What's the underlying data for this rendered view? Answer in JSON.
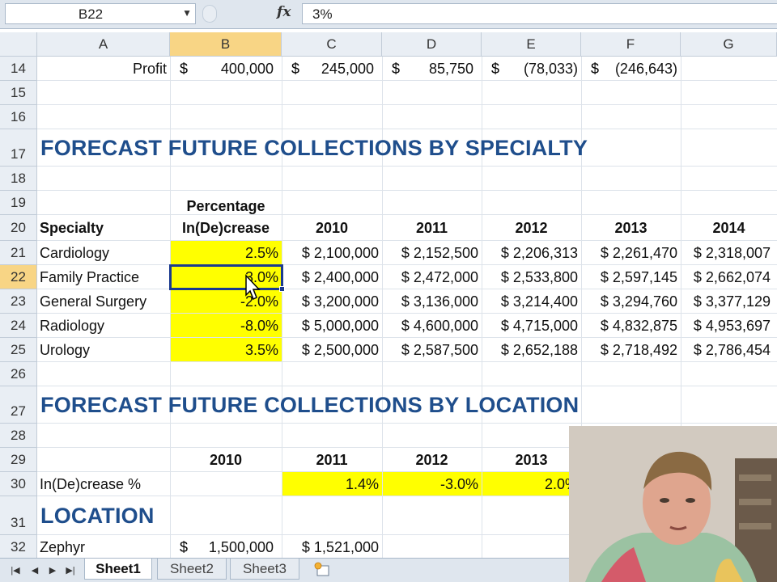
{
  "formula_bar": {
    "name_box": "B22",
    "fx_label": "fx",
    "content": "3%"
  },
  "columns": [
    "A",
    "B",
    "C",
    "D",
    "E",
    "F",
    "G"
  ],
  "rows": [
    "14",
    "15",
    "16",
    "17",
    "18",
    "19",
    "20",
    "21",
    "22",
    "23",
    "24",
    "25",
    "26",
    "27",
    "28",
    "29",
    "30",
    "31",
    "32"
  ],
  "profit_row": {
    "label": "Profit",
    "currency": "$",
    "values": [
      "400,000",
      "245,000",
      "85,750",
      "(78,033)",
      "(246,643)"
    ]
  },
  "specialty_section": {
    "title": "FORECAST FUTURE COLLECTIONS BY SPECIALTY",
    "pct_header_line1": "Percentage",
    "pct_header_line2": "In(De)crease",
    "specialty_header": "Specialty",
    "years": [
      "2010",
      "2011",
      "2012",
      "2013",
      "2014"
    ],
    "rows": [
      {
        "name": "Cardiology",
        "pct": "2.5%",
        "values": [
          "$ 2,100,000",
          "$ 2,152,500",
          "$ 2,206,313",
          "$ 2,261,470",
          "$ 2,318,007"
        ]
      },
      {
        "name": "Family Practice",
        "pct": "3.0%",
        "values": [
          "$ 2,400,000",
          "$ 2,472,000",
          "$ 2,533,800",
          "$ 2,597,145",
          "$ 2,662,074"
        ]
      },
      {
        "name": "General Surgery",
        "pct": "-2.0%",
        "values": [
          "$ 3,200,000",
          "$ 3,136,000",
          "$ 3,214,400",
          "$ 3,294,760",
          "$ 3,377,129"
        ]
      },
      {
        "name": "Radiology",
        "pct": "-8.0%",
        "values": [
          "$ 5,000,000",
          "$ 4,600,000",
          "$ 4,715,000",
          "$ 4,832,875",
          "$ 4,953,697"
        ]
      },
      {
        "name": "Urology",
        "pct": "3.5%",
        "values": [
          "$ 2,500,000",
          "$ 2,587,500",
          "$ 2,652,188",
          "$ 2,718,492",
          "$ 2,786,454"
        ]
      }
    ]
  },
  "location_section": {
    "title": "FORECAST FUTURE COLLECTIONS BY LOCATION",
    "years": [
      "2010",
      "2011",
      "2012",
      "2013"
    ],
    "increase_label": "In(De)crease %",
    "increase_values": [
      "1.4%",
      "-3.0%",
      "2.0%"
    ],
    "location_header": "LOCATION",
    "zephyr": {
      "name": "Zephyr",
      "currency": "$",
      "value_2010": "1,500,000",
      "value_2011": "$ 1,521,000"
    }
  },
  "sheet_tabs": [
    "Sheet1",
    "Sheet2",
    "Sheet3"
  ],
  "active_tab": "Sheet1",
  "colors": {
    "highlight": "#ffff00",
    "title_blue": "#1f4e8c",
    "selection": "#1b3a8f",
    "header_selected": "#f8d585"
  }
}
